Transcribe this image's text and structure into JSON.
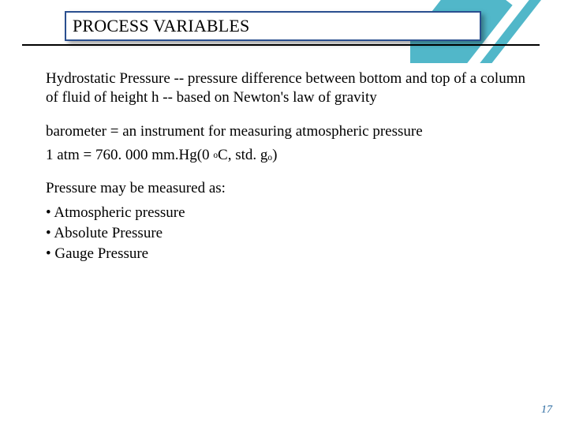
{
  "header": {
    "title": "PROCESS VARIABLES"
  },
  "body": {
    "hydro": "Hydrostatic Pressure -- pressure difference between bottom and top of a column of fluid of height h -- based on Newton's law of gravity",
    "barometer": "barometer = an instrument for measuring atmospheric pressure",
    "atm_prefix": "1 atm = 760. 000 mm.Hg(0 ",
    "atm_deg": "o",
    "atm_mid": "C, std. g",
    "atm_sub": "o",
    "atm_suffix": ")",
    "measured_intro": "Pressure may be measured as:",
    "b1": "• Atmospheric pressure",
    "b2": "• Absolute Pressure",
    "b3": "• Gauge Pressure"
  },
  "page": {
    "number": "17"
  }
}
